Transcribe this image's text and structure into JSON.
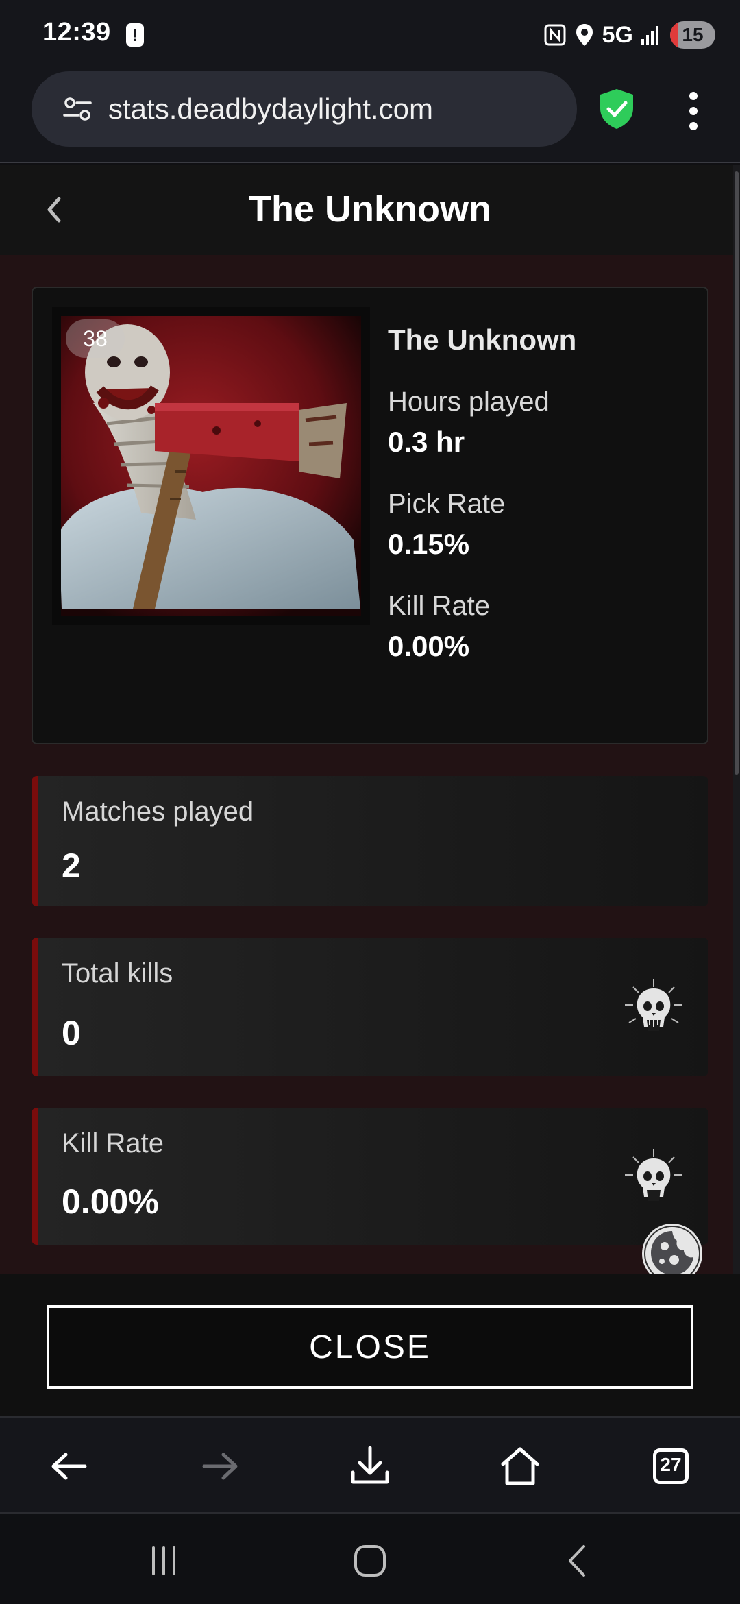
{
  "status_bar": {
    "time": "12:39",
    "alert_icon": "!",
    "network": "5G",
    "battery": "15"
  },
  "browser": {
    "url": "stats.deadbydaylight.com",
    "tab_count": "27"
  },
  "header": {
    "title": "The Unknown"
  },
  "killer_card": {
    "level": "38",
    "name": "The Unknown",
    "stats": [
      {
        "label": "Hours played",
        "value": "0.3 hr"
      },
      {
        "label": "Pick Rate",
        "value": "0.15%"
      },
      {
        "label": "Kill Rate",
        "value": "0.00%"
      }
    ]
  },
  "stat_boxes": [
    {
      "label": "Matches played",
      "value": "2",
      "icon": null
    },
    {
      "label": "Total kills",
      "value": "0",
      "icon": "skull-icon"
    },
    {
      "label": "Kill Rate",
      "value": "0.00%",
      "icon": "skull-icon"
    }
  ],
  "close_label": "CLOSE",
  "colors": {
    "accent_red": "#7a0c0c",
    "page_bg": "#221214",
    "shield_green": "#2ecc5a"
  }
}
